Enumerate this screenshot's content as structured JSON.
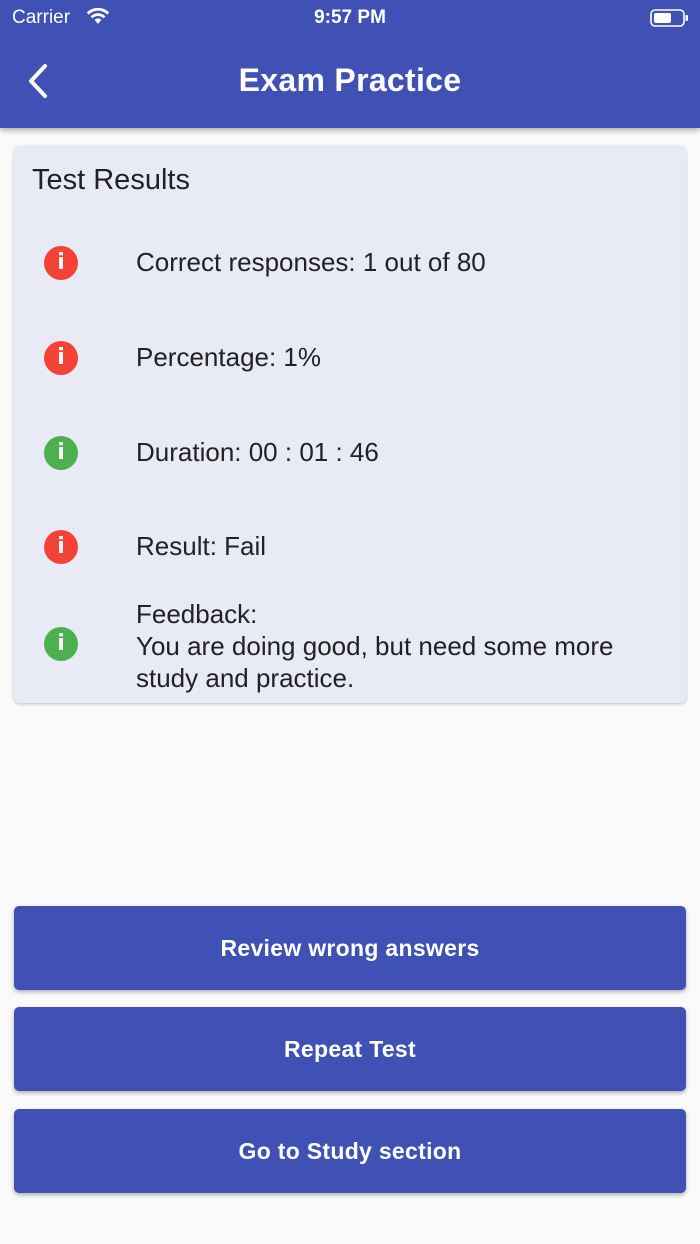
{
  "status_bar": {
    "carrier": "Carrier",
    "time": "9:57 PM"
  },
  "header": {
    "title": "Exam Practice",
    "back_icon": "chevron-left-icon",
    "background_color": "#3f51b5"
  },
  "results": {
    "title": "Test Results",
    "items": [
      {
        "icon": "info-icon",
        "status": "red",
        "label": "Correct responses: 1 out of 80"
      },
      {
        "icon": "info-icon",
        "status": "red",
        "label": "Percentage: 1%"
      },
      {
        "icon": "info-icon",
        "status": "green",
        "label": "Duration: 00 : 01 : 46"
      },
      {
        "icon": "info-icon",
        "status": "red",
        "label": "Result: Fail"
      },
      {
        "icon": "info-icon",
        "status": "green",
        "label_line1": "Feedback:",
        "label_line2": "You are doing good, but need some more study and practice."
      }
    ]
  },
  "actions": {
    "review_label": "Review wrong answers",
    "repeat_label": "Repeat Test",
    "study_label": "Go to Study section"
  },
  "colors": {
    "primary": "#3f51b5",
    "card_bg": "#e8eaf6",
    "fail_red": "#f44336",
    "pass_green": "#4caf50"
  }
}
